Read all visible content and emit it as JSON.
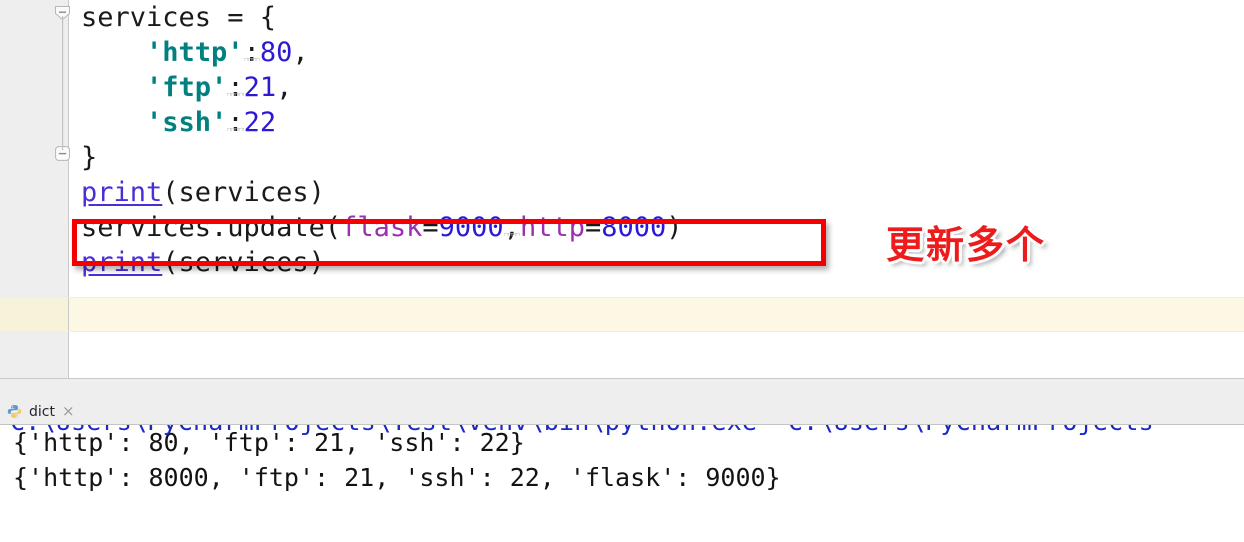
{
  "editor": {
    "lines": [
      {
        "id": "line-dict-open",
        "fold": "shield",
        "tokens": [
          {
            "cls": "s-plain",
            "text": "services = {"
          }
        ]
      },
      {
        "id": "line-http",
        "fold": "none",
        "tokens": [
          {
            "cls": "s-plain",
            "text": "    "
          },
          {
            "cls": "s-str",
            "text": "'http'"
          },
          {
            "cls": "s-punct squig",
            "text": ":"
          },
          {
            "cls": "s-num",
            "text": "80"
          },
          {
            "cls": "s-plain",
            "text": ","
          }
        ]
      },
      {
        "id": "line-ftp",
        "fold": "none",
        "tokens": [
          {
            "cls": "s-plain",
            "text": "    "
          },
          {
            "cls": "s-str",
            "text": "'ftp'"
          },
          {
            "cls": "s-punct squig",
            "text": ":"
          },
          {
            "cls": "s-num",
            "text": "21"
          },
          {
            "cls": "s-plain",
            "text": ","
          }
        ]
      },
      {
        "id": "line-ssh",
        "fold": "none",
        "tokens": [
          {
            "cls": "s-plain",
            "text": "    "
          },
          {
            "cls": "s-str",
            "text": "'ssh'"
          },
          {
            "cls": "s-punct squig",
            "text": ":"
          },
          {
            "cls": "s-num",
            "text": "22"
          }
        ]
      },
      {
        "id": "line-dict-close",
        "fold": "square",
        "tokens": [
          {
            "cls": "s-plain",
            "text": "}"
          }
        ]
      },
      {
        "id": "line-print-1",
        "fold": "none",
        "tokens": [
          {
            "cls": "s-bi",
            "text": "print"
          },
          {
            "cls": "s-plain",
            "text": "(services)"
          }
        ]
      },
      {
        "id": "line-update",
        "fold": "none",
        "tokens": [
          {
            "cls": "s-plain",
            "text": "services.update("
          },
          {
            "cls": "s-kwarg",
            "text": "flask"
          },
          {
            "cls": "s-plain",
            "text": "="
          },
          {
            "cls": "s-num",
            "text": "9000"
          },
          {
            "cls": "s-plain squig",
            "text": ","
          },
          {
            "cls": "s-kwarg",
            "text": "http"
          },
          {
            "cls": "s-plain",
            "text": "="
          },
          {
            "cls": "s-num",
            "text": "8000"
          },
          {
            "cls": "s-plain",
            "text": ")"
          }
        ]
      },
      {
        "id": "line-print-2",
        "fold": "none",
        "tokens": [
          {
            "cls": "s-bi",
            "text": "print"
          },
          {
            "cls": "s-plain",
            "text": "(services)"
          }
        ]
      }
    ],
    "plain_text": [
      "services = {",
      "    'http':80,",
      "    'ftp':21,",
      "    'ssh':22",
      "}",
      "print(services)",
      "services.update(flask=9000,http=8000)",
      "print(services)"
    ]
  },
  "annotation": {
    "text": "更新多个",
    "box_color": "#f40000",
    "text_color": "#ec1c1c",
    "outline_color": "#ffffff",
    "target_line": "services.update(flask=9000,http=8000)"
  },
  "run_panel": {
    "tab": {
      "label": "dict",
      "icon": "python-file-icon",
      "close": "×"
    },
    "scrolled_path_line": "C:\\Users\\PyCharmProjects\\Test\\venv\\bin\\python.exe\" C:\\Users\\PyCharmProjects",
    "output": [
      "{'http': 80, 'ftp': 21, 'ssh': 22}",
      "{'http': 8000, 'ftp': 21, 'ssh': 22, 'flask': 9000}"
    ]
  },
  "theme": {
    "gutter_bg": "#eeeeee",
    "editor_bg": "#ffffff",
    "caret_line": "#fdf8e3",
    "string_color": "#008080",
    "number_color": "#2c19d6",
    "kwarg_color": "#9b2fae",
    "builtin_color": "#4b2fd6",
    "text_color": "#1a1a1a",
    "console_path_color": "#1a29c8"
  }
}
